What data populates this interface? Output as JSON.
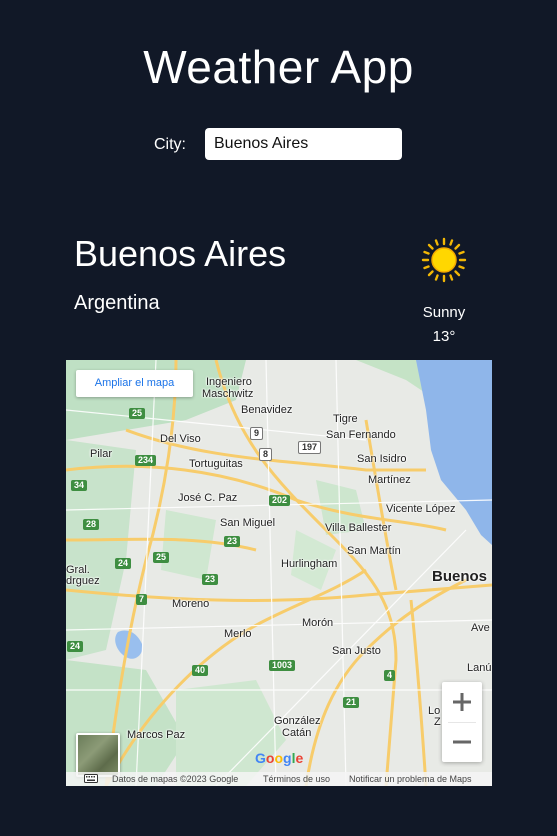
{
  "app": {
    "title": "Weather App"
  },
  "search": {
    "label": "City:",
    "value": "Buenos Aires"
  },
  "location": {
    "city": "Buenos Aires",
    "country": "Argentina"
  },
  "weather": {
    "condition": "Sunny",
    "temperature": "13°",
    "icon": "sun-icon"
  },
  "map": {
    "expand_label": "Ampliar el mapa",
    "attribution": "Datos de mapas ©2023 Google",
    "terms": "Términos de uso",
    "report": "Notificar un problema de Maps",
    "places": {
      "ingeniero": "Ingeniero",
      "maschwitz": "Maschwitz",
      "benavidez": "Benavidez",
      "tigre": "Tigre",
      "san_fernando": "San Fernando",
      "del_viso": "Del Viso",
      "pilar": "Pilar",
      "tortuguitas": "Tortuguitas",
      "san_isidro": "San Isidro",
      "martinez": "Martínez",
      "jose_c_paz": "José C. Paz",
      "vicente_lopez": "Vicente López",
      "san_miguel": "San Miguel",
      "villa_ballester": "Villa Ballester",
      "san_martin": "San Martín",
      "hurlingham": "Hurlingham",
      "gral": "Gral.",
      "rodriguez": "drguez",
      "buenos": "Buenos",
      "moreno": "Moreno",
      "merlo": "Merlo",
      "moron": "Morón",
      "ave": "Ave",
      "san_justo": "San Justo",
      "lanus": "Lanú",
      "lo": "Lo",
      "z": "Z",
      "gonzalez": "González",
      "catan": "Catán",
      "marcos_paz": "Marcos Paz"
    },
    "shields": {
      "r25a": "25",
      "r9": "9",
      "r197": "197",
      "r8": "8",
      "r234": "234",
      "r34": "34",
      "r202": "202",
      "r28": "28",
      "r23a": "23",
      "r24a": "24",
      "r25b": "25",
      "r23b": "23",
      "r7": "7",
      "r24b": "24",
      "r40": "40",
      "r1003": "1003",
      "r4": "4",
      "r21": "21"
    }
  }
}
